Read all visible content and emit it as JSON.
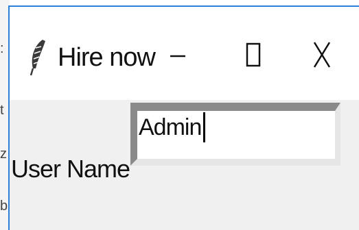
{
  "window": {
    "title": "Hire now",
    "accent_color": "#2b7fd6",
    "icon": "feather-icon",
    "controls": [
      "minimize-icon",
      "maximize-icon",
      "close-icon"
    ]
  },
  "form": {
    "username_label": "User Name",
    "username_value": "Admin"
  }
}
